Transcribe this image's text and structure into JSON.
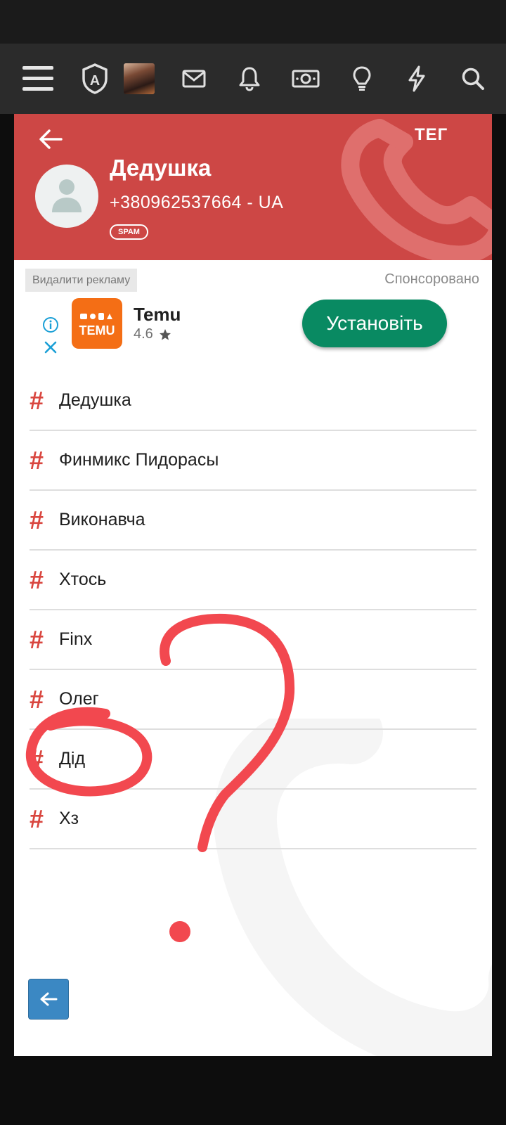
{
  "toolbar": {
    "icons": [
      "menu-icon",
      "shield-a-icon",
      "profile-avatar",
      "mail-icon",
      "bell-icon",
      "money-icon",
      "lightbulb-icon",
      "lightning-icon",
      "search-icon"
    ]
  },
  "header": {
    "tag_link": "ТЕГ",
    "contact_name": "Дедушка",
    "phone": "+380962537664 - UA",
    "spam_badge": "SPAM"
  },
  "ad": {
    "remove_ads": "Видалити рекламу",
    "sponsored": "Спонсоровано",
    "app_name": "Temu",
    "rating": "4.6",
    "app_logo_text": "TEMU",
    "install_label": "Установіть"
  },
  "tags": [
    {
      "hash": "#",
      "label": "Дедушка"
    },
    {
      "hash": "#",
      "label": "Финмикс Пидорасы"
    },
    {
      "hash": "#",
      "label": "Виконавча"
    },
    {
      "hash": "#",
      "label": "Хтось"
    },
    {
      "hash": "#",
      "label": "Finx"
    },
    {
      "hash": "#",
      "label": "Олег"
    },
    {
      "hash": "#",
      "label": "Дід"
    },
    {
      "hash": "#",
      "label": "Хз"
    }
  ],
  "colors": {
    "header_red": "#cd4745",
    "toolbar_bg": "#2b2b2b",
    "install_green": "#098a62",
    "hash_red": "#d9463f",
    "annotation_red": "#f2484f",
    "back_button_blue": "#3b88c3"
  }
}
